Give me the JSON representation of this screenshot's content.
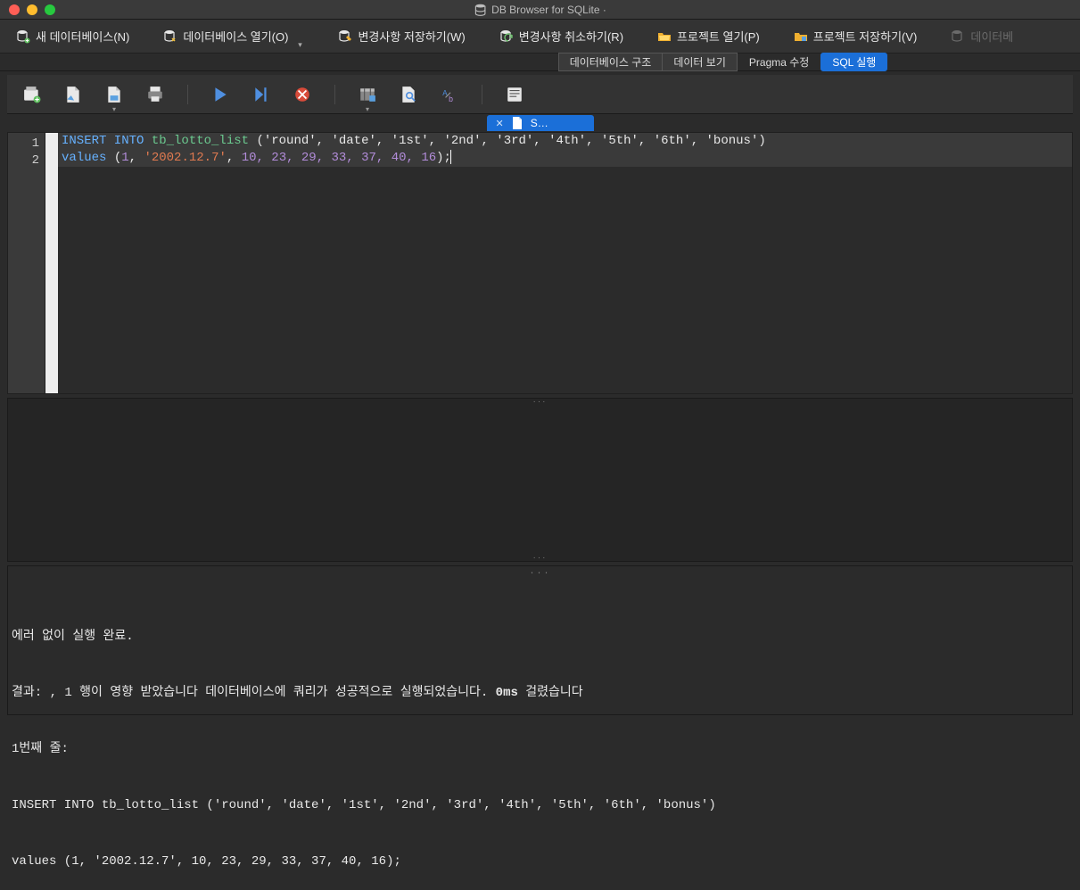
{
  "app": {
    "title": "DB Browser for SQLite ·"
  },
  "toolbar": {
    "new_db": "새 데이터베이스(N)",
    "open_db": "데이터베이스 열기(O)",
    "write_changes": "변경사항 저장하기(W)",
    "revert_changes": "변경사항 취소하기(R)",
    "open_project": "프로젝트 열기(P)",
    "save_project": "프로젝트 저장하기(V)",
    "attach_db_trunc": "데이터베"
  },
  "tabs": {
    "db_structure": "데이터베이스 구조",
    "browse_data": "데이터 보기",
    "edit_pragma": "Pragma 수정",
    "execute_sql": "SQL 실행"
  },
  "editor": {
    "tab_label": "S…",
    "line_numbers": [
      "1",
      "2"
    ],
    "l1": {
      "insert_into": "INSERT INTO",
      "table": " tb_lotto_list",
      "rest": " ('round', 'date', '1st', '2nd', '3rd', '4th', '5th', '6th', 'bonus')"
    },
    "l2": {
      "values_kw": "values",
      "paren_open": " (",
      "num1": "1",
      "c1": ", ",
      "str1": "'2002.12.7'",
      "c2": ", ",
      "nums_rest": "10, 23, 29, 33, 37, 40, 16",
      "paren_close": ");"
    }
  },
  "output": {
    "line1": "에러 없이 실행 완료.",
    "line2_a": "결과: , 1 행이 영향 받았습니다 데이터베이스에 쿼리가 성공적으로 실행되었습니다. ",
    "line2_b": "0ms",
    "line2_c": " 걸렸습니다",
    "line3": "1번째 줄:",
    "line4": "INSERT INTO tb_lotto_list ('round', 'date', '1st', '2nd', '3rd', '4th', '5th', '6th', 'bonus')",
    "line5": "values (1, '2002.12.7', 10, 23, 29, 33, 37, 40, 16);"
  }
}
